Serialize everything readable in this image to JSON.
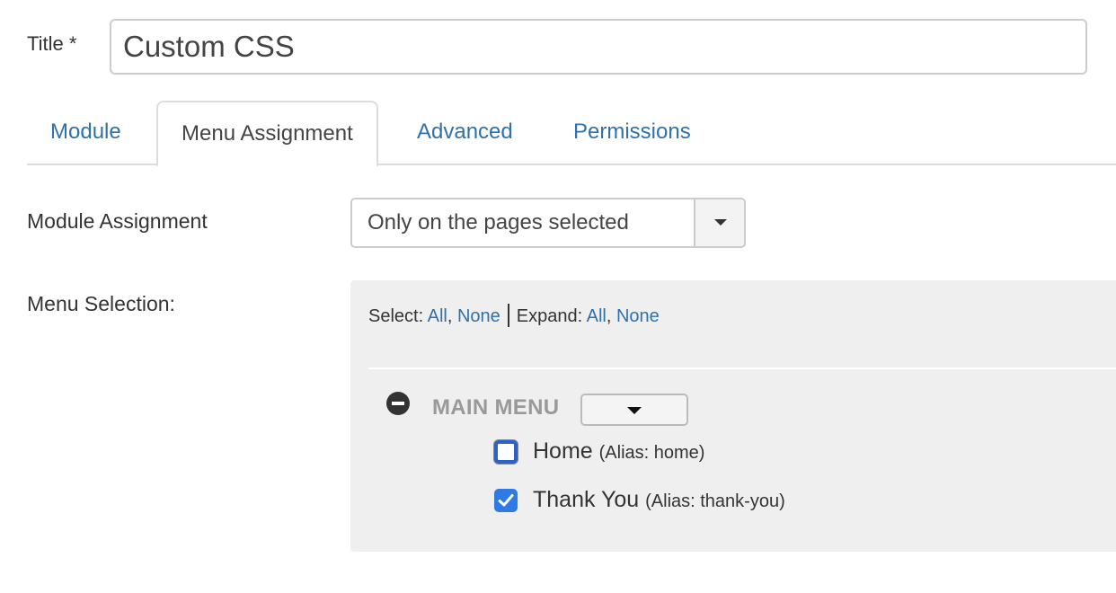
{
  "title_field": {
    "label": "Title *",
    "value": "Custom CSS"
  },
  "tabs": [
    {
      "label": "Module",
      "active": false
    },
    {
      "label": "Menu Assignment",
      "active": true
    },
    {
      "label": "Advanced",
      "active": false
    },
    {
      "label": "Permissions",
      "active": false
    }
  ],
  "module_assignment": {
    "label": "Module Assignment",
    "selected": "Only on the pages selected"
  },
  "menu_selection": {
    "label": "Menu Selection:",
    "select_label": "Select:",
    "select_all": "All",
    "select_none": "None",
    "expand_label": "Expand:",
    "expand_all": "All",
    "expand_none": "None",
    "menu": {
      "icon": "minus-circle-icon",
      "title": "MAIN MENU",
      "items": [
        {
          "label": "Home",
          "alias": "(Alias: home)",
          "checked": false,
          "focused": true
        },
        {
          "label": "Thank You",
          "alias": "(Alias: thank-you)",
          "checked": true
        }
      ]
    }
  },
  "colors": {
    "link": "#3071a9",
    "panel_bg": "#efefef",
    "checkbox_checked": "#2f7ae5"
  }
}
